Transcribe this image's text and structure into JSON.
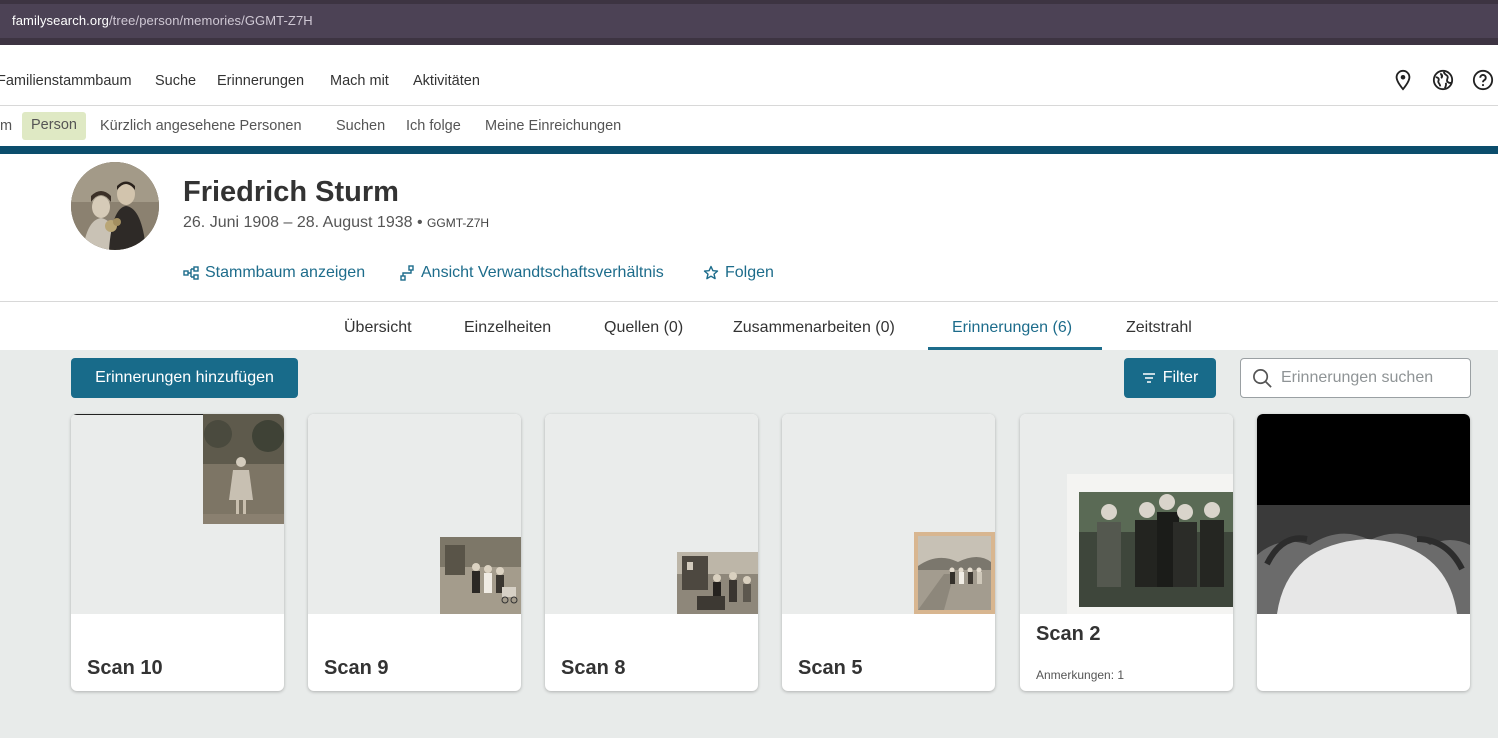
{
  "browser": {
    "url_host": "familysearch.org",
    "url_path": "/tree/person/memories/GGMT-Z7H"
  },
  "topnav": {
    "items": [
      "Familienstammbaum",
      "Suche",
      "Erinnerungen",
      "Mach mit",
      "Aktivitäten"
    ],
    "icons": [
      "location-pin-icon",
      "globe-icon",
      "help-icon"
    ]
  },
  "subnav": {
    "partial": "m",
    "active": "Person",
    "items": [
      "Kürzlich angesehene Personen",
      "Suchen",
      "Ich folge",
      "Meine Einreichungen"
    ]
  },
  "person": {
    "name": "Friedrich Sturm",
    "dates": "26. Juni 1908 – 28. August 1938",
    "separator": "•",
    "pid": "GGMT-Z7H",
    "links": [
      "Stammbaum anzeigen",
      "Ansicht Verwandtschaftsverhältnis",
      "Folgen"
    ]
  },
  "tabs": {
    "items": [
      "Übersicht",
      "Einzelheiten",
      "Quellen (0)",
      "Zusammenarbeiten (0)",
      "Erinnerungen (6)",
      "Zeitstrahl"
    ],
    "active": "Erinnerungen (6)"
  },
  "toolbar": {
    "add_label": "Erinnerungen hinzufügen",
    "filter_label": "Filter",
    "search_placeholder": "Erinnerungen suchen"
  },
  "memories": [
    {
      "title": "Scan 10",
      "note": ""
    },
    {
      "title": "Scan 9",
      "note": ""
    },
    {
      "title": "Scan 8",
      "note": ""
    },
    {
      "title": "Scan 5",
      "note": ""
    },
    {
      "title": "Scan 2",
      "note": "Anmerkungen: 1"
    },
    {
      "title": "",
      "note": ""
    }
  ],
  "colors": {
    "accent": "#186b8a",
    "link": "#1d6c8b",
    "band": "#0b4d6c",
    "active_pill": "#dfe9c4"
  }
}
